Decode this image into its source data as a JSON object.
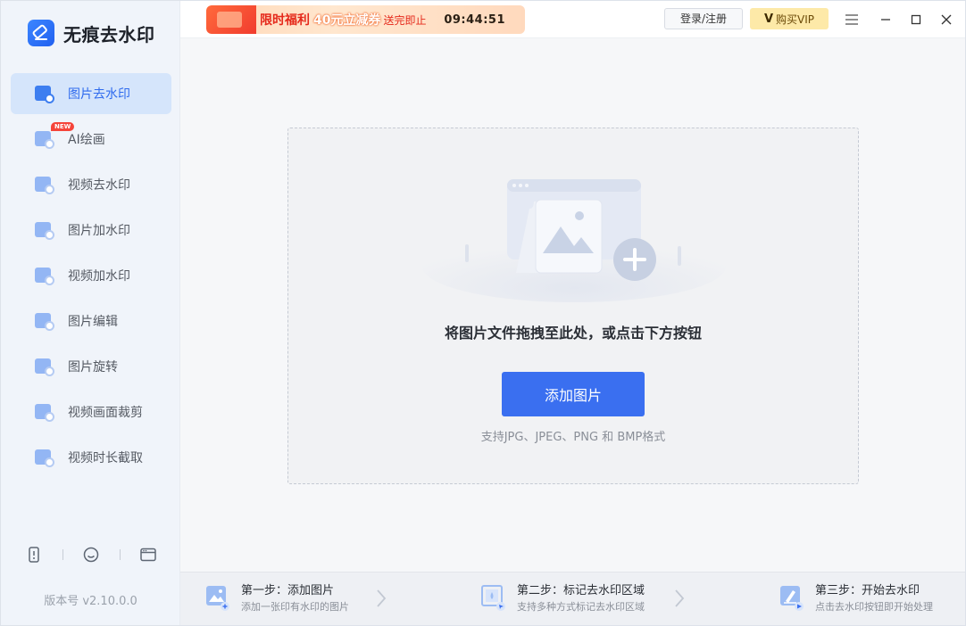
{
  "app": {
    "name": "无痕去水印",
    "version": "版本号 v2.10.0.0"
  },
  "sidebar": {
    "items": [
      {
        "label": "图片去水印",
        "active": true
      },
      {
        "label": "AI绘画",
        "badge": "NEW"
      },
      {
        "label": "视频去水印"
      },
      {
        "label": "图片加水印"
      },
      {
        "label": "视频加水印"
      },
      {
        "label": "图片编辑"
      },
      {
        "label": "图片旋转"
      },
      {
        "label": "视频画面裁剪"
      },
      {
        "label": "视频时长截取"
      }
    ],
    "tools": [
      "phone-icon",
      "smile-icon",
      "browser-icon"
    ]
  },
  "topbar": {
    "promo": {
      "title": "限时福利",
      "amount": "40元立减券",
      "sub": "送完即止",
      "timer": "09:44:51"
    },
    "login_label": "登录/注册",
    "vip_label": "购买VIP",
    "vip_mark": "V"
  },
  "dropzone": {
    "hint": "将图片文件拖拽至此处，或点击下方按钮",
    "button": "添加图片",
    "formats": "支持JPG、JPEG、PNG 和 BMP格式"
  },
  "steps": [
    {
      "title": "第一步：添加图片",
      "desc": "添加一张印有水印的图片"
    },
    {
      "title": "第二步：标记去水印区域",
      "desc": "支持多种方式标记去水印区域"
    },
    {
      "title": "第三步：开始去水印",
      "desc": "点击去水印按钮即开始处理"
    }
  ],
  "colors": {
    "accent": "#3a6ff0",
    "sidebar_bg": "#f0f4fa",
    "active_bg": "#d5e5fb",
    "promo_red": "#e5291b",
    "vip_bg": "#fde9a8"
  }
}
